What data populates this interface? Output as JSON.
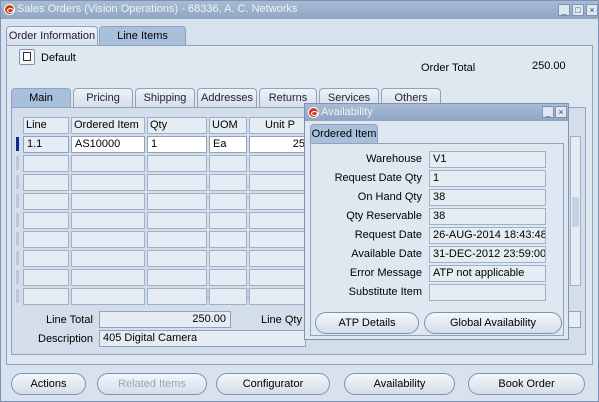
{
  "window": {
    "title": "Sales Orders (Vision Operations) - 68336, A. C. Networks"
  },
  "top_tabs": [
    {
      "label": "Order Information"
    },
    {
      "label": "Line Items"
    }
  ],
  "header": {
    "default_label": "Default",
    "order_total_label": "Order Total",
    "order_total_value": "250.00"
  },
  "line_tabs": [
    {
      "label": "Main"
    },
    {
      "label": "Pricing"
    },
    {
      "label": "Shipping"
    },
    {
      "label": "Addresses"
    },
    {
      "label": "Returns"
    },
    {
      "label": "Services"
    },
    {
      "label": "Others"
    }
  ],
  "table": {
    "columns": [
      "Line",
      "Ordered Item",
      "Qty",
      "UOM",
      "Unit P"
    ],
    "rows": [
      {
        "line": "1.1",
        "ordered_item": "AS10000",
        "qty": "1",
        "uom": "Ea",
        "unit_price": "25"
      }
    ]
  },
  "footer": {
    "line_total_label": "Line Total",
    "line_total_value": "250.00",
    "line_qty_label": "Line Qty",
    "description_label": "Description",
    "description_value": "405 Digital Camera"
  },
  "buttons": {
    "actions": "Actions",
    "related_items": "Related Items",
    "configurator": "Configurator",
    "availability": "Availability",
    "book_order": "Book Order"
  },
  "popup": {
    "title": "Availability",
    "tab": "Ordered Item",
    "fields": [
      {
        "label": "Warehouse",
        "value": "V1"
      },
      {
        "label": "Request Date Qty",
        "value": "1"
      },
      {
        "label": "On Hand Qty",
        "value": "38"
      },
      {
        "label": "Qty Reservable",
        "value": "38"
      },
      {
        "label": "Request Date",
        "value": "26-AUG-2014 18:43:48"
      },
      {
        "label": "Available Date",
        "value": "31-DEC-2012 23:59:00"
      },
      {
        "label": "Error Message",
        "value": "ATP not applicable"
      },
      {
        "label": "Substitute Item",
        "value": ""
      }
    ],
    "atp_details": "ATP Details",
    "global_availability": "Global Availability"
  }
}
